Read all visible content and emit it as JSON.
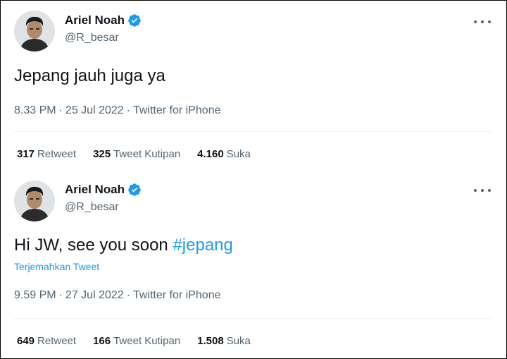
{
  "colors": {
    "accent": "#1d9bf0",
    "text": "#0f1419",
    "muted": "#536471",
    "divider": "#eff3f4"
  },
  "tweets": [
    {
      "author": {
        "name": "Ariel Noah",
        "handle": "@R_besar",
        "verified_icon": "verified-badge-icon"
      },
      "text": "Jepang jauh juga ya",
      "time": "8.33 PM",
      "date": "25 Jul 2022",
      "source": "Twitter for iPhone",
      "separator": "·",
      "stats": {
        "retweets": "317",
        "retweets_label": "Retweet",
        "quotes": "325",
        "quotes_label": "Tweet Kutipan",
        "likes": "4.160",
        "likes_label": "Suka"
      }
    },
    {
      "author": {
        "name": "Ariel Noah",
        "handle": "@R_besar",
        "verified_icon": "verified-badge-icon"
      },
      "text_prefix": "Hi JW, see you soon ",
      "hashtag": "#jepang",
      "translate_link": "Terjemahkan Tweet",
      "time": "9.59 PM",
      "date": "27 Jul 2022",
      "source": "Twitter for iPhone",
      "separator": "·",
      "stats": {
        "retweets": "649",
        "retweets_label": "Retweet",
        "quotes": "166",
        "quotes_label": "Tweet Kutipan",
        "likes": "1.508",
        "likes_label": "Suka"
      }
    }
  ]
}
